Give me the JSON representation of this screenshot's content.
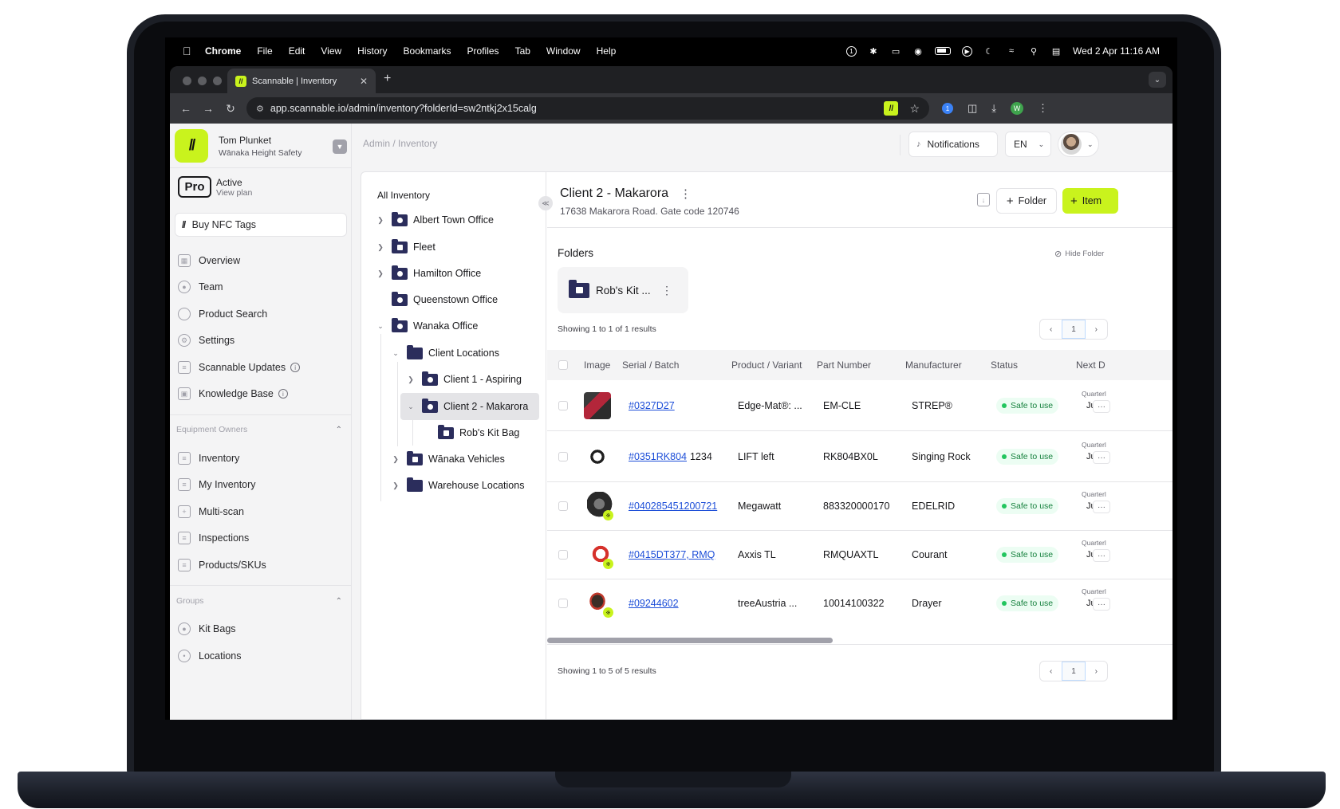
{
  "menubar": {
    "app": "Chrome",
    "items": [
      "File",
      "Edit",
      "View",
      "History",
      "Bookmarks",
      "Profiles",
      "Tab",
      "Window",
      "Help"
    ],
    "clock": "Wed 2 Apr  11:16 AM"
  },
  "browser": {
    "tab_title": "Scannable | Inventory",
    "url": "app.scannable.io/admin/inventory?folderId=sw2ntkj2x15calg",
    "profile_initial": "W"
  },
  "sidebar": {
    "user_name": "Tom Plunket",
    "org_name": "Wānaka Height Safety",
    "plan_badge": "Pro",
    "plan_status": "Active",
    "plan_link": "View plan",
    "buy_label": "Buy NFC Tags",
    "nav": [
      {
        "label": "Overview",
        "icon": "grid-icon"
      },
      {
        "label": "Team",
        "icon": "users-icon"
      },
      {
        "label": "Product Search",
        "icon": "search-icon"
      },
      {
        "label": "Settings",
        "icon": "gear-icon"
      },
      {
        "label": "Scannable Updates",
        "icon": "document-icon"
      },
      {
        "label": "Knowledge Base",
        "icon": "book-icon"
      }
    ],
    "owners_heading": "Equipment Owners",
    "owners": [
      {
        "label": "Inventory",
        "icon": "list-icon"
      },
      {
        "label": "My Inventory",
        "icon": "user-list-icon"
      },
      {
        "label": "Multi-scan",
        "icon": "scan-icon"
      },
      {
        "label": "Inspections",
        "icon": "clipboard-icon"
      },
      {
        "label": "Products/SKUs",
        "icon": "box-icon"
      }
    ],
    "groups_heading": "Groups",
    "groups": [
      {
        "label": "Kit Bags",
        "icon": "bag-icon"
      },
      {
        "label": "Locations",
        "icon": "pin-icon"
      }
    ]
  },
  "topbar": {
    "breadcrumb_root": "Admin",
    "breadcrumb_current": "Inventory",
    "notifications_label": "Notifications",
    "language": "EN"
  },
  "tree": {
    "title": "All Inventory",
    "nodes": [
      {
        "label": "Albert Town Office"
      },
      {
        "label": "Fleet"
      },
      {
        "label": "Hamilton Office"
      },
      {
        "label": "Queenstown Office"
      },
      {
        "label": "Wanaka Office"
      },
      {
        "label": "Client Locations"
      },
      {
        "label": "Client 1 - Aspiring"
      },
      {
        "label": "Client 2 - Makarora"
      },
      {
        "label": "Rob's Kit Bag"
      },
      {
        "label": "Wānaka Vehicles"
      },
      {
        "label": "Warehouse Locations"
      }
    ]
  },
  "detail": {
    "title": "Client 2 - Makarora",
    "subtitle": "17638 Makarora Road. Gate code 120746",
    "folder_button": "Folder",
    "item_button": "Item",
    "folders_heading": "Folders",
    "hide_folders_label": "Hide Folder",
    "folder_card_label": "Rob's Kit ...",
    "folders_showing": "Showing 1 to 1 of 1 results",
    "page_number": "1",
    "items_showing": "Showing 1 to 5 of 5 results"
  },
  "table": {
    "columns": [
      "Image",
      "Serial / Batch",
      "Product / Variant",
      "Part Number",
      "Manufacturer",
      "Status",
      "Next D"
    ],
    "rows": [
      {
        "serial": "#0327D27",
        "batch": "",
        "product": "Edge-Mat®: ...",
        "part": "EM-CLE",
        "manufacturer": "STREP®",
        "status": "Safe to use",
        "next_label": "Quarterl",
        "next_value": "Ju"
      },
      {
        "serial": "#0351RK804",
        "batch": "1234",
        "product": "LIFT left",
        "part": "RK804BX0L",
        "manufacturer": "Singing Rock",
        "status": "Safe to use",
        "next_label": "Quarterl",
        "next_value": "Ju"
      },
      {
        "serial": "#040285451200721",
        "batch": "",
        "product": "Megawatt",
        "part": "883320000170",
        "manufacturer": "EDELRID",
        "status": "Safe to use",
        "next_label": "Quarterl",
        "next_value": "Ju"
      },
      {
        "serial": "#0415DT377, RMQ",
        "batch": "",
        "product": "Axxis TL",
        "part": "RMQUAXTL",
        "manufacturer": "Courant",
        "status": "Safe to use",
        "next_label": "Quarterl",
        "next_value": "Ju"
      },
      {
        "serial": "#09244602",
        "batch": "",
        "product": "treeAustria ...",
        "part": "10014100322",
        "manufacturer": "Drayer",
        "status": "Safe to use",
        "next_label": "Quarterl",
        "next_value": "Ju"
      }
    ]
  },
  "colors": {
    "brand_lime": "#c9f31d",
    "folder_navy": "#2b2d5c",
    "link_blue": "#1d4ed8",
    "status_green": "#15803d"
  }
}
